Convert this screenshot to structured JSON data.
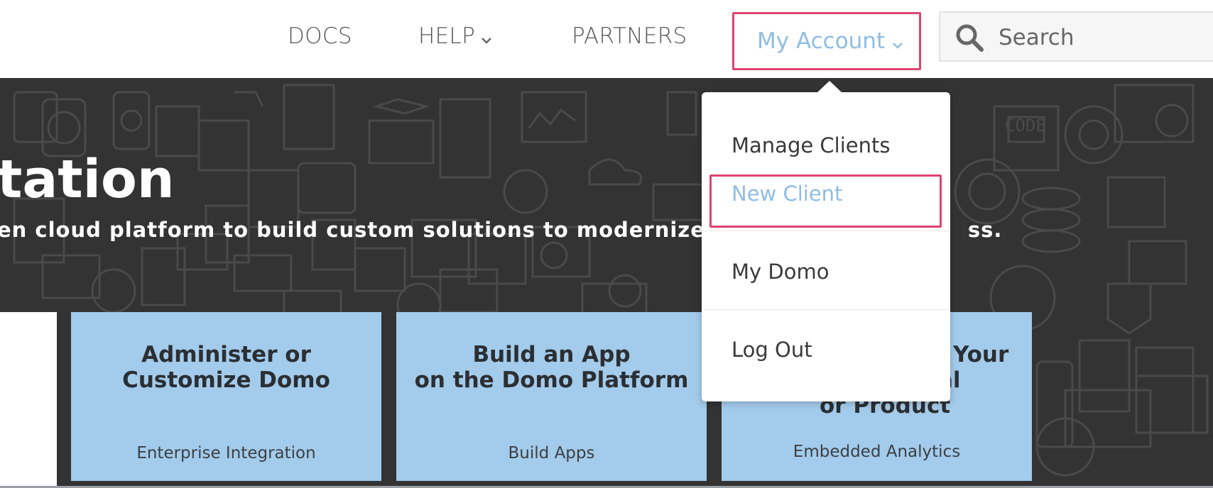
{
  "nav": {
    "docs": "DOCS",
    "help": "HELP",
    "partners": "PARTNERS",
    "account": "My Account",
    "search_placeholder": "Search"
  },
  "hero": {
    "title": "tation",
    "subtitle": "en cloud platform to build custom solutions to modernize",
    "subtitle_tail": "ss."
  },
  "dropdown": {
    "items": [
      {
        "label": "Manage Clients"
      },
      {
        "label": "New Client"
      },
      {
        "label": "My Domo"
      },
      {
        "label": "Log Out"
      }
    ],
    "active_index": 1
  },
  "cards": [
    {
      "title": "Administer or\nCustomize Domo",
      "subtitle": "Enterprise Integration"
    },
    {
      "title": "Build an App\non the Domo Platform",
      "subtitle": "Build Apps"
    },
    {
      "title_visible_fragments": [
        "Your",
        "al",
        "or Product"
      ],
      "subtitle": "Embedded Analytics"
    }
  ],
  "colors": {
    "accent_highlight": "#e0436f",
    "link_active": "#8fbde4",
    "card_bg": "#a3cbeb",
    "hero_bg": "#333333"
  }
}
